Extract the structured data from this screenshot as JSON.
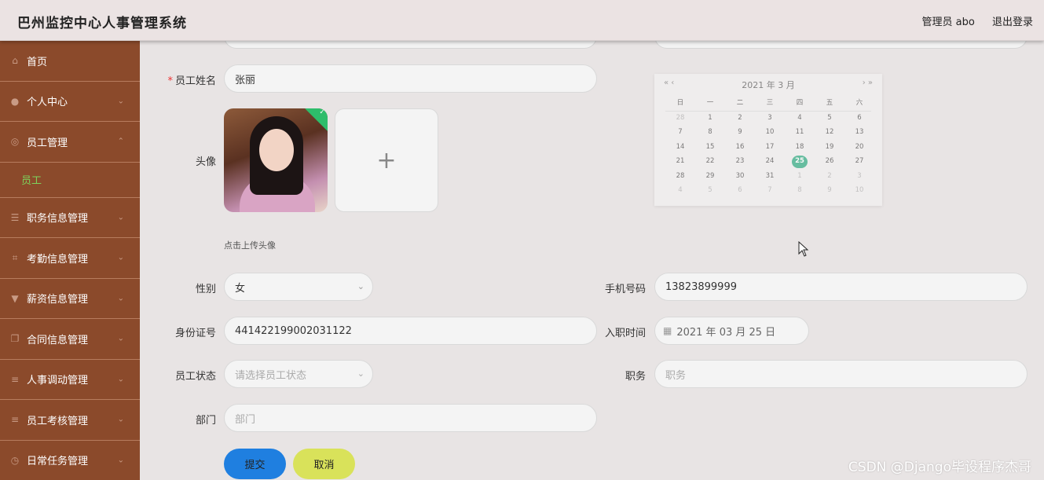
{
  "app": {
    "title": "巴州监控中心人事管理系统",
    "user_label": "管理员 abo",
    "logout_label": "退出登录"
  },
  "sidebar": {
    "items": [
      {
        "label": "首页",
        "icon": "home-icon"
      },
      {
        "label": "个人中心",
        "icon": "user-icon"
      },
      {
        "label": "员工管理",
        "icon": "circle-icon",
        "expanded": true,
        "sub": "员工"
      },
      {
        "label": "职务信息管理",
        "icon": "sliders-icon"
      },
      {
        "label": "考勤信息管理",
        "icon": "crop-icon"
      },
      {
        "label": "薪资信息管理",
        "icon": "flag-icon"
      },
      {
        "label": "合同信息管理",
        "icon": "copy-icon"
      },
      {
        "label": "人事调动管理",
        "icon": "menu-icon"
      },
      {
        "label": "员工考核管理",
        "icon": "menu-icon"
      },
      {
        "label": "日常任务管理",
        "icon": "clock-icon"
      }
    ]
  },
  "form": {
    "name_label": "员工姓名",
    "name_value": "张丽",
    "avatar_label": "头像",
    "upload_hint": "点击上传头像",
    "gender_label": "性别",
    "gender_value": "女",
    "phone_label": "手机号码",
    "phone_value": "13823899999",
    "id_label": "身份证号",
    "id_value": "441422199002031122",
    "hire_label": "入职时间",
    "hire_value": "2021 年 03 月 25 日",
    "status_label": "员工状态",
    "status_placeholder": "请选择员工状态",
    "position_label": "职务",
    "position_placeholder": "职务",
    "dept_label": "部门",
    "dept_placeholder": "部门",
    "submit_label": "提交",
    "cancel_label": "取消"
  },
  "calendar": {
    "header": "2021 年  3 月",
    "prev": "« ‹",
    "next": "› »",
    "weekdays": [
      "日",
      "一",
      "二",
      "三",
      "四",
      "五",
      "六"
    ],
    "days": [
      "28",
      "1",
      "2",
      "3",
      "4",
      "5",
      "6",
      "7",
      "8",
      "9",
      "10",
      "11",
      "12",
      "13",
      "14",
      "15",
      "16",
      "17",
      "18",
      "19",
      "20",
      "21",
      "22",
      "23",
      "24",
      "25",
      "26",
      "27",
      "28",
      "29",
      "30",
      "31",
      "1",
      "2",
      "3",
      "4",
      "5",
      "6",
      "7",
      "8",
      "9",
      "10"
    ],
    "selected": "25"
  },
  "watermark": "CSDN @Django毕设程序杰哥",
  "colors": {
    "sidebar": "#8b4a2b",
    "submenu_active": "#7dd35c",
    "submit": "#1f7fe0",
    "cancel": "#d9e25a",
    "selected_day": "#3cb08a"
  }
}
